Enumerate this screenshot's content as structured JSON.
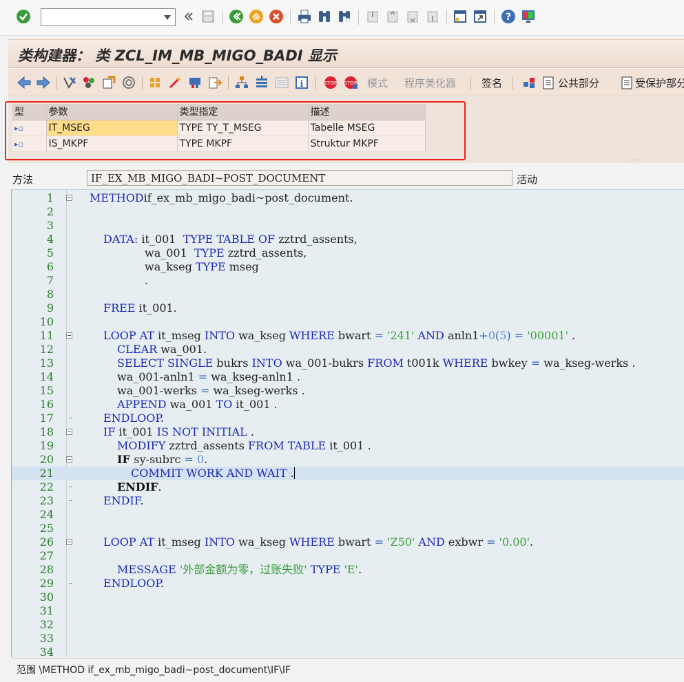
{
  "system_toolbar": {
    "command_field": {
      "value": ""
    },
    "icons": [
      "enter-check-icon",
      "command-dropdown-icon",
      "collapse-toolbar-icon",
      "save-icon",
      "back-icon",
      "exit-icon",
      "cancel-icon",
      "print-icon",
      "find-icon",
      "find-next-icon",
      "first-page-icon",
      "previous-page-icon",
      "next-page-icon",
      "last-page-icon",
      "create-session-icon",
      "shortcut-icon",
      "help-icon",
      "customize-layout-icon"
    ]
  },
  "title_bar": {
    "title": "类构建器： 类 ZCL_IM_MB_MIGO_BADI 显示"
  },
  "app_toolbar": {
    "mode_label": "模式",
    "pretty_printer_label": "程序美化器",
    "signature_label": "签名",
    "public_section_label": "公共部分",
    "protected_section_label": "受保护部分"
  },
  "parameters": {
    "headers": [
      "型",
      "参数",
      "类型指定",
      "描述"
    ],
    "rows": [
      {
        "type_icon": "▸▫",
        "name": "IT_MSEG",
        "typing": "TYPE TY_T_MSEG",
        "description": "Tabelle MSEG",
        "highlighted": true
      },
      {
        "type_icon": "▸▫",
        "name": "IS_MKPF",
        "typing": "TYPE MKPF",
        "description": "Struktur MKPF",
        "highlighted": false
      }
    ]
  },
  "method_row": {
    "label": "方法",
    "method_name": "IF_EX_MB_MIGO_BADI~POST_DOCUMENT",
    "status": "活动"
  },
  "editor": {
    "current_line": 21,
    "lines": [
      {
        "n": "1",
        "fold": "box",
        "t": [
          [
            "kw",
            "METHOD"
          ],
          [
            "",
            "if_ex_mb_migo_badi~post_document."
          ]
        ],
        "indent": 0
      },
      {
        "n": "2",
        "t": []
      },
      {
        "n": "3",
        "t": []
      },
      {
        "n": "4",
        "indent": 2,
        "t": [
          [
            "kw",
            "DATA: "
          ],
          [
            "",
            "it_001  "
          ],
          [
            "kw",
            "TYPE TABLE OF "
          ],
          [
            "",
            "zztrd_assents,"
          ]
        ]
      },
      {
        "n": "5",
        "indent": 8,
        "t": [
          [
            "",
            "wa_001  "
          ],
          [
            "kw",
            "TYPE "
          ],
          [
            "",
            "zztrd_assents,"
          ]
        ]
      },
      {
        "n": "6",
        "indent": 8,
        "t": [
          [
            "",
            "wa_kseg "
          ],
          [
            "kw",
            "TYPE "
          ],
          [
            "",
            "mseg"
          ]
        ]
      },
      {
        "n": "7",
        "indent": 8,
        "t": [
          [
            "",
            "."
          ]
        ]
      },
      {
        "n": "8",
        "t": []
      },
      {
        "n": "9",
        "indent": 2,
        "t": [
          [
            "kw",
            "FREE "
          ],
          [
            "",
            "it_001."
          ]
        ]
      },
      {
        "n": "10",
        "t": []
      },
      {
        "n": "11",
        "fold": "box",
        "indent": 2,
        "t": [
          [
            "kw",
            "LOOP AT "
          ],
          [
            "",
            "it_mseg "
          ],
          [
            "kw",
            "INTO "
          ],
          [
            "",
            "wa_kseg "
          ],
          [
            "kw",
            "WHERE "
          ],
          [
            "",
            "bwart "
          ],
          [
            "op",
            "="
          ],
          [
            "str",
            " '241' "
          ],
          [
            "kw",
            "AND "
          ],
          [
            "",
            "anln1"
          ],
          [
            "op",
            "+"
          ],
          [
            "num",
            "0"
          ],
          [
            "op",
            "("
          ],
          [
            "num",
            "5"
          ],
          [
            "op",
            ")"
          ],
          [
            "",
            " "
          ],
          [
            "op",
            "="
          ],
          [
            "str",
            " '00001' "
          ],
          [
            "",
            "."
          ]
        ]
      },
      {
        "n": "12",
        "indent": 4,
        "t": [
          [
            "kw",
            "CLEAR "
          ],
          [
            "",
            "wa_001."
          ]
        ]
      },
      {
        "n": "13",
        "indent": 4,
        "t": [
          [
            "kw",
            "SELECT SINGLE "
          ],
          [
            "",
            "bukrs "
          ],
          [
            "kw",
            "INTO "
          ],
          [
            "",
            "wa_001-bukrs "
          ],
          [
            "kw",
            "FROM "
          ],
          [
            "",
            "t001k "
          ],
          [
            "kw",
            "WHERE "
          ],
          [
            "",
            "bwkey "
          ],
          [
            "op",
            "="
          ],
          [
            "",
            " wa_kseg-werks ."
          ]
        ]
      },
      {
        "n": "14",
        "indent": 4,
        "t": [
          [
            "",
            "wa_001-anln1 "
          ],
          [
            "op",
            "="
          ],
          [
            "",
            " wa_kseg-anln1 ."
          ]
        ]
      },
      {
        "n": "15",
        "indent": 4,
        "t": [
          [
            "",
            "wa_001-werks "
          ],
          [
            "op",
            "="
          ],
          [
            "",
            " wa_kseg-werks ."
          ]
        ]
      },
      {
        "n": "16",
        "indent": 4,
        "t": [
          [
            "kw",
            "APPEND "
          ],
          [
            "",
            "wa_001 "
          ],
          [
            "kw",
            "TO "
          ],
          [
            "",
            "it_001 ."
          ]
        ]
      },
      {
        "n": "17",
        "fold": "tick",
        "indent": 2,
        "t": [
          [
            "kw",
            "ENDLOOP"
          ],
          [
            "",
            "."
          ]
        ]
      },
      {
        "n": "18",
        "fold": "box",
        "indent": 2,
        "t": [
          [
            "kw",
            "IF "
          ],
          [
            "",
            "it_001 "
          ],
          [
            "kw",
            "IS NOT INITIAL "
          ],
          [
            "",
            "."
          ]
        ]
      },
      {
        "n": "19",
        "indent": 4,
        "t": [
          [
            "kw",
            "MODIFY "
          ],
          [
            "",
            "zztrd_assents "
          ],
          [
            "kw",
            "FROM TABLE "
          ],
          [
            "",
            "it_001 ."
          ]
        ]
      },
      {
        "n": "20",
        "fold": "box",
        "indent": 4,
        "t": [
          [
            "kwb",
            "IF "
          ],
          [
            "",
            "sy-subrc "
          ],
          [
            "op",
            "="
          ],
          [
            "",
            " "
          ],
          [
            "num",
            "0"
          ],
          [
            "",
            "."
          ]
        ]
      },
      {
        "n": "21",
        "indent": 6,
        "caret": true,
        "t": [
          [
            "kw",
            "COMMIT WORK AND WAIT "
          ],
          [
            "",
            "."
          ]
        ]
      },
      {
        "n": "22",
        "fold": "tick",
        "indent": 4,
        "t": [
          [
            "kwb",
            "ENDIF"
          ],
          [
            "",
            "."
          ]
        ]
      },
      {
        "n": "23",
        "fold": "tick",
        "indent": 2,
        "t": [
          [
            "kw",
            "ENDIF"
          ],
          [
            "",
            "."
          ]
        ]
      },
      {
        "n": "24",
        "t": []
      },
      {
        "n": "25",
        "t": []
      },
      {
        "n": "26",
        "fold": "box",
        "indent": 2,
        "t": [
          [
            "kw",
            "LOOP AT "
          ],
          [
            "",
            "it_mseg "
          ],
          [
            "kw",
            "INTO "
          ],
          [
            "",
            "wa_kseg "
          ],
          [
            "kw",
            "WHERE "
          ],
          [
            "",
            "bwart "
          ],
          [
            "op",
            "="
          ],
          [
            "str",
            " 'Z50' "
          ],
          [
            "kw",
            "AND "
          ],
          [
            "",
            "exbwr "
          ],
          [
            "op",
            "="
          ],
          [
            "str",
            " '0.00'"
          ],
          [
            "",
            "."
          ]
        ]
      },
      {
        "n": "27",
        "t": []
      },
      {
        "n": "28",
        "indent": 4,
        "t": [
          [
            "kw",
            "MESSAGE "
          ],
          [
            "str",
            "'外部金额为零，过账失败' "
          ],
          [
            "kw",
            "TYPE "
          ],
          [
            "str",
            "'E'"
          ],
          [
            "",
            "."
          ]
        ]
      },
      {
        "n": "29",
        "fold": "tick",
        "indent": 2,
        "t": [
          [
            "kw",
            "ENDLOOP"
          ],
          [
            "",
            "."
          ]
        ]
      },
      {
        "n": "30",
        "t": []
      },
      {
        "n": "31",
        "t": []
      },
      {
        "n": "32",
        "t": []
      },
      {
        "n": "33",
        "t": []
      },
      {
        "n": "34",
        "t": []
      }
    ]
  },
  "status_bar": {
    "text": "范围 \\METHOD if_ex_mb_migo_badi~post_document\\IF\\IF"
  },
  "colors": {
    "title_bg": "#eddcd0",
    "param_highlight": "#fddc8a",
    "keyword": "#1f29b8",
    "string": "#3e9d3e",
    "red_box": "#e8241c"
  }
}
